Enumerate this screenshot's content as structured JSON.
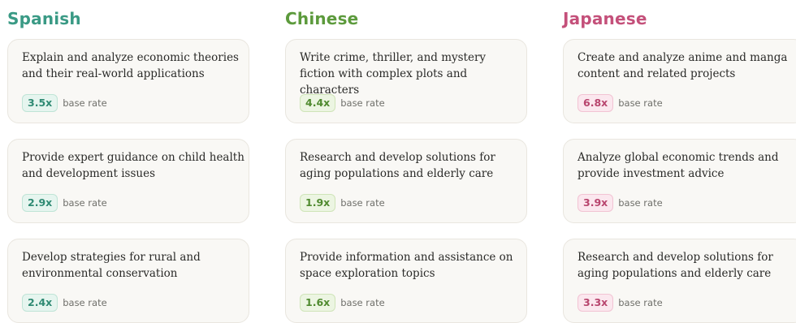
{
  "columns": [
    {
      "title": "Spanish",
      "title_color": "#3a9a85",
      "badge_text_color": "#2f8a73",
      "badge_bg": "#e6f5ef",
      "badge_border": "#bfe4d6",
      "cards": [
        {
          "text": "Explain and analyze economic theories and their real-world applications",
          "rate": "3.5x",
          "rate_label": "base rate"
        },
        {
          "text": "Provide expert guidance on child health and development issues",
          "rate": "2.9x",
          "rate_label": "base rate"
        },
        {
          "text": "Develop strategies for rural and environmental conservation",
          "rate": "2.4x",
          "rate_label": "base rate"
        }
      ]
    },
    {
      "title": "Chinese",
      "title_color": "#5c9a3c",
      "badge_text_color": "#4f8a2f",
      "badge_bg": "#ecf5e2",
      "badge_border": "#cfe4b8",
      "cards": [
        {
          "text": "Write crime, thriller, and mystery fiction with complex plots and characters",
          "rate": "4.4x",
          "rate_label": "base rate"
        },
        {
          "text": "Research and develop solutions for aging populations and elderly care",
          "rate": "1.9x",
          "rate_label": "base rate"
        },
        {
          "text": "Provide information and assistance on space exploration topics",
          "rate": "1.6x",
          "rate_label": "base rate"
        }
      ]
    },
    {
      "title": "Japanese",
      "title_color": "#c4507a",
      "badge_text_color": "#b8456e",
      "badge_bg": "#fbe7ee",
      "badge_border": "#f2c3d3",
      "cards": [
        {
          "text": "Create and analyze anime and manga content and related projects",
          "rate": "6.8x",
          "rate_label": "base rate"
        },
        {
          "text": "Analyze global economic trends and provide investment advice",
          "rate": "3.9x",
          "rate_label": "base rate"
        },
        {
          "text": "Research and develop solutions for aging populations and elderly care",
          "rate": "3.3x",
          "rate_label": "base rate"
        }
      ]
    }
  ]
}
